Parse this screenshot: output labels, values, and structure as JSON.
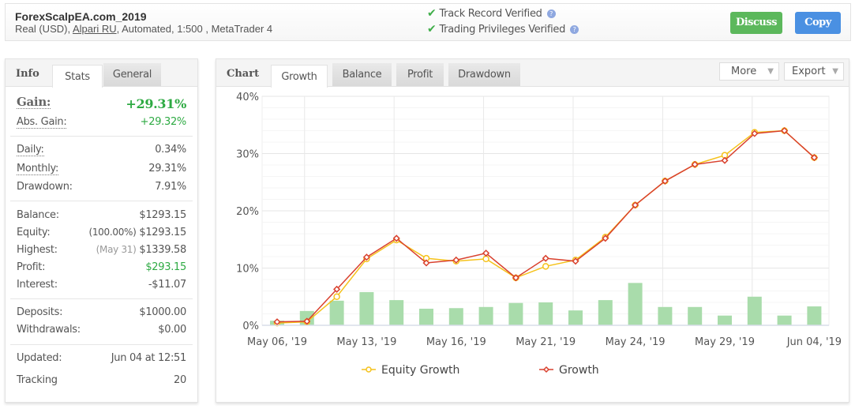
{
  "header": {
    "system_name": "ForexScalpEA.com_2019",
    "sub_prefix": "Real (USD), ",
    "broker": "Alpari RU",
    "sub_suffix": ", Automated, 1:500 , MetaTrader 4",
    "verifications": [
      {
        "label": "Track Record Verified",
        "icon": "check-icon",
        "help": "?"
      },
      {
        "label": "Trading Privileges Verified",
        "icon": "check-icon",
        "help": "?"
      }
    ],
    "discuss_label": "Discuss",
    "copy_label": "Copy",
    "colors": {
      "discuss": "#5cb85c",
      "copy": "#4a90e2"
    }
  },
  "info": {
    "title": "Info",
    "tabs": [
      "Stats",
      "General"
    ],
    "active_tab": "Stats",
    "gain_label": "Gain:",
    "gain_value": "+29.31%",
    "abs_gain_label": "Abs. Gain:",
    "abs_gain_value": "+29.32%",
    "daily_label": "Daily:",
    "daily_value": "0.34%",
    "monthly_label": "Monthly:",
    "monthly_value": "29.31%",
    "drawdown_label": "Drawdown:",
    "drawdown_value": "7.91%",
    "balance_label": "Balance:",
    "balance_value": "$1293.15",
    "equity_label": "Equity:",
    "equity_pct": "(100.00%)",
    "equity_value": "$1293.15",
    "highest_label": "Highest:",
    "highest_date": "(May 31)",
    "highest_value": "$1339.58",
    "profit_label": "Profit:",
    "profit_value": "$293.15",
    "interest_label": "Interest:",
    "interest_value": "-$11.07",
    "deposits_label": "Deposits:",
    "deposits_value": "$1000.00",
    "withdrawals_label": "Withdrawals:",
    "withdrawals_value": "$0.00",
    "updated_label": "Updated:",
    "updated_value": "Jun 04 at 12:51",
    "tracking_label": "Tracking",
    "tracking_value": "20"
  },
  "chart_panel": {
    "title": "Chart",
    "tabs": [
      "Growth",
      "Balance",
      "Profit",
      "Drawdown"
    ],
    "active_tab": "Growth",
    "more_label": "More",
    "export_label": "Export"
  },
  "chart_data": {
    "type": "line",
    "title": "",
    "xlabel": "",
    "ylabel": "",
    "ylim": [
      0,
      40
    ],
    "yticks": [
      "0%",
      "10%",
      "20%",
      "30%",
      "40%"
    ],
    "ytick_values": [
      0,
      10,
      20,
      30,
      40
    ],
    "grid": true,
    "point_count": 19,
    "x_tick_labels": [
      {
        "index": 0,
        "label": "May 06, '19"
      },
      {
        "index": 3,
        "label": "May 13, '19"
      },
      {
        "index": 6,
        "label": "May 16, '19"
      },
      {
        "index": 9,
        "label": "May 21, '19"
      },
      {
        "index": 12,
        "label": "May 24, '19"
      },
      {
        "index": 15,
        "label": "May 29, '19"
      },
      {
        "index": 18,
        "label": "Jun 04, '19"
      }
    ],
    "vgrid_after_index": [
      0,
      3,
      6,
      9,
      12,
      15
    ],
    "series": [
      {
        "name": "Equity Growth",
        "type": "line",
        "color": "#f5c21b",
        "marker": "circle",
        "values": [
          0.4,
          0.6,
          5.0,
          11.6,
          14.9,
          11.7,
          11.2,
          11.6,
          8.3,
          10.3,
          11.4,
          15.4,
          21.0,
          25.2,
          28.1,
          29.7,
          33.7,
          34.0,
          29.3
        ]
      },
      {
        "name": "Growth",
        "type": "line",
        "color": "#d9412e",
        "marker": "diamond",
        "values": [
          0.6,
          0.7,
          6.3,
          11.9,
          15.2,
          10.9,
          11.4,
          12.6,
          8.3,
          11.7,
          11.2,
          15.2,
          21.0,
          25.2,
          28.1,
          28.8,
          33.5,
          34.0,
          29.3
        ]
      },
      {
        "name": "Daily",
        "type": "bar",
        "color": "#a9dcab",
        "show_in_legend": false,
        "values": [
          0.8,
          2.5,
          4.3,
          5.8,
          4.4,
          2.9,
          3.0,
          3.2,
          3.9,
          4.0,
          2.6,
          4.4,
          7.4,
          3.2,
          3.2,
          1.7,
          5.0,
          1.7,
          3.3
        ]
      }
    ],
    "legend": {
      "position": "bottom",
      "entries": [
        "Equity Growth",
        "Growth"
      ]
    }
  }
}
